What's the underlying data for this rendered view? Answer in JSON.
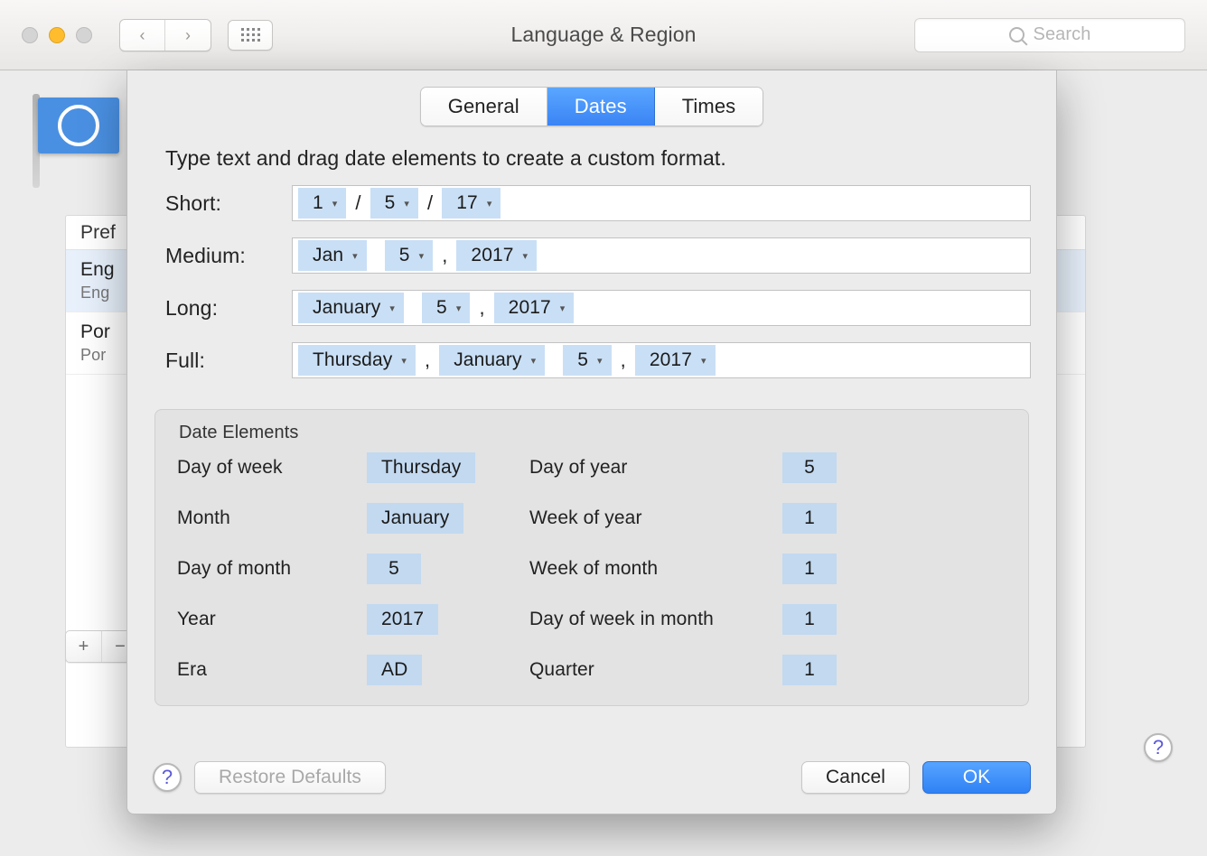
{
  "toolbar": {
    "title": "Language & Region",
    "search_placeholder": "Search"
  },
  "background": {
    "pref_header": "Pref",
    "languages": [
      {
        "title": "Eng",
        "subtitle": "Eng"
      },
      {
        "title": "Por",
        "subtitle": "Por"
      }
    ],
    "add": "+",
    "remove": "−"
  },
  "sheet": {
    "tabs": {
      "general": "General",
      "dates": "Dates",
      "times": "Times"
    },
    "instruction": "Type text and drag date elements to create a custom format.",
    "rows": {
      "short": {
        "label": "Short:",
        "tokens": [
          "1",
          "5",
          "17"
        ],
        "seps": [
          "/",
          "/"
        ]
      },
      "medium": {
        "label": "Medium:",
        "tokens": [
          "Jan",
          "5",
          "2017"
        ],
        "seps": [
          "",
          ","
        ]
      },
      "long": {
        "label": "Long:",
        "tokens": [
          "January",
          "5",
          "2017"
        ],
        "seps": [
          "",
          ","
        ]
      },
      "full": {
        "label": "Full:",
        "tokens": [
          "Thursday",
          "January",
          "5",
          "2017"
        ],
        "seps": [
          ",",
          "",
          ","
        ]
      }
    },
    "elements": {
      "title": "Date Elements",
      "left": [
        {
          "label": "Day of week",
          "value": "Thursday"
        },
        {
          "label": "Month",
          "value": "January"
        },
        {
          "label": "Day of month",
          "value": "5"
        },
        {
          "label": "Year",
          "value": "2017"
        },
        {
          "label": "Era",
          "value": "AD"
        }
      ],
      "right": [
        {
          "label": "Day of year",
          "value": "5"
        },
        {
          "label": "Week of year",
          "value": "1"
        },
        {
          "label": "Week of month",
          "value": "1"
        },
        {
          "label": "Day of week in month",
          "value": "1"
        },
        {
          "label": "Quarter",
          "value": "1"
        }
      ]
    },
    "buttons": {
      "restore": "Restore Defaults",
      "cancel": "Cancel",
      "ok": "OK"
    }
  }
}
